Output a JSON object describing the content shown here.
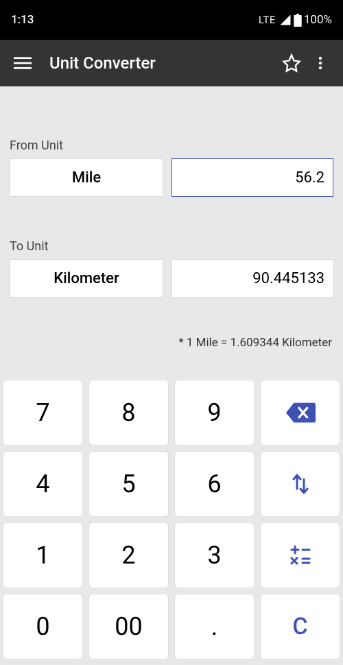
{
  "status": {
    "time": "1:13",
    "network": "LTE",
    "battery": "100%"
  },
  "appbar": {
    "title": "Unit Converter"
  },
  "from": {
    "label": "From Unit",
    "unit": "Mile",
    "value": "56.2"
  },
  "to": {
    "label": "To Unit",
    "unit": "Kilometer",
    "value": "90.445133"
  },
  "rate_note": "* 1 Mile = 1.609344 Kilometer",
  "keys": {
    "k7": "7",
    "k8": "8",
    "k9": "9",
    "k4": "4",
    "k5": "5",
    "k6": "6",
    "k1": "1",
    "k2": "2",
    "k3": "3",
    "k0": "0",
    "k00": "00",
    "kdot": ".",
    "clear": "C"
  }
}
